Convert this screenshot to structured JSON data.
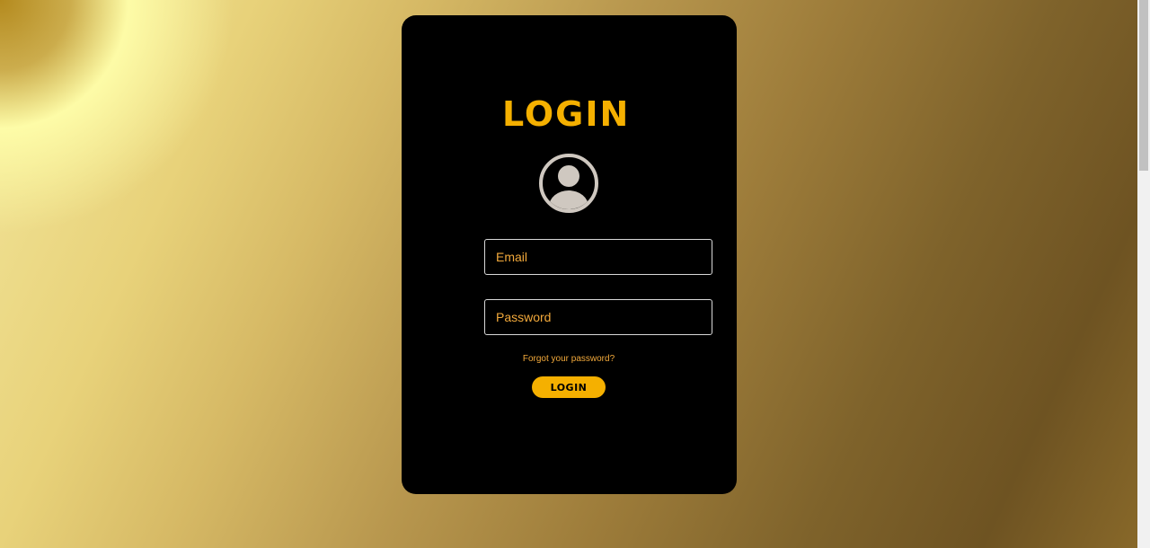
{
  "login_card": {
    "title": "LOGIN",
    "avatar_icon": "user-circle-icon",
    "email": {
      "placeholder": "Email",
      "value": ""
    },
    "password": {
      "placeholder": "Password",
      "value": ""
    },
    "forgot_password_label": "Forgot your password?",
    "login_button_label": "LOGIN"
  },
  "colors": {
    "accent": "#f5b000",
    "placeholder_text": "#f2a93b",
    "card_background": "#000000",
    "avatar": "#cfc8c0"
  }
}
